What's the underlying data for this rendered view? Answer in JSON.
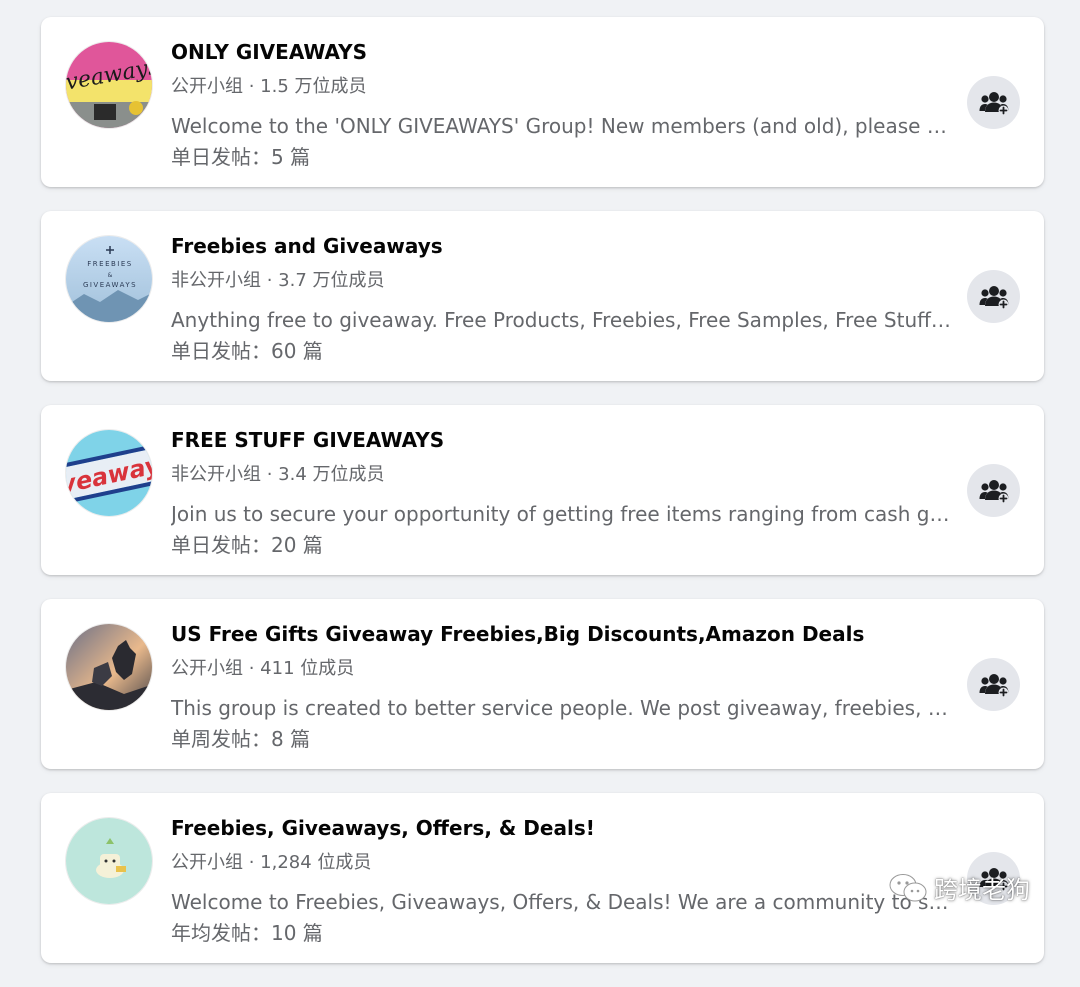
{
  "groups": [
    {
      "name": "ONLY GIVEAWAYS",
      "meta": "公开小组 · 1.5 万位成员",
      "description": "Welcome to the 'ONLY GIVEAWAYS' Group! New members (and old), please read the rules before posting.",
      "posts": "单日发帖：5 篇",
      "avatar_text": "iveaways",
      "avatar_colors": [
        "#e0569a",
        "#f3e36b",
        "#8a8f8c"
      ]
    },
    {
      "name": "Freebies and Giveaways",
      "meta": "非公开小组 · 3.7 万位成员",
      "description": "Anything free to giveaway. Free Products, Freebies, Free Samples, Free Stuff, Giveaways and more.",
      "posts": "单日发帖：60 篇",
      "avatar_text_top": "FREEBIES",
      "avatar_text_mid": "&",
      "avatar_text_bottom": "GIVEAWAYS",
      "avatar_colors": [
        "#c9dff4",
        "#9fbfd9",
        "#6f94b3"
      ]
    },
    {
      "name": "FREE STUFF GIVEAWAYS",
      "meta": "非公开小组 · 3.4 万位成员",
      "description": "Join us to secure your opportunity of getting free items ranging from cash giveaways and more.",
      "posts": "单日发帖：20 篇",
      "avatar_text": "veaway",
      "avatar_colors": [
        "#7fd3e8",
        "#1f3f8c",
        "#d9333b"
      ]
    },
    {
      "name": "US Free Gifts Giveaway Freebies,Big Discounts,Amazon Deals",
      "meta": "公开小组 · 411 位成员",
      "description": "This group is created to better service people. We post giveaway, freebies, big discounts and deals.",
      "posts": "单周发帖：8 篇",
      "avatar_colors": [
        "#e9b98c",
        "#6b6f86",
        "#2c2c33"
      ]
    },
    {
      "name": "Freebies, Giveaways, Offers, & Deals!",
      "meta": "公开小组 · 1,284 位成员",
      "description": "Welcome to Freebies, Giveaways, Offers, & Deals! We are a community to share free stuff.",
      "posts": "年均发帖：10 篇",
      "avatar_colors": [
        "#bde6dc",
        "#f5f1d8",
        "#8cc26a"
      ]
    }
  ],
  "join_icon": "people-add-icon",
  "watermark": {
    "text": "跨境老狗",
    "icon": "wechat-icon"
  }
}
